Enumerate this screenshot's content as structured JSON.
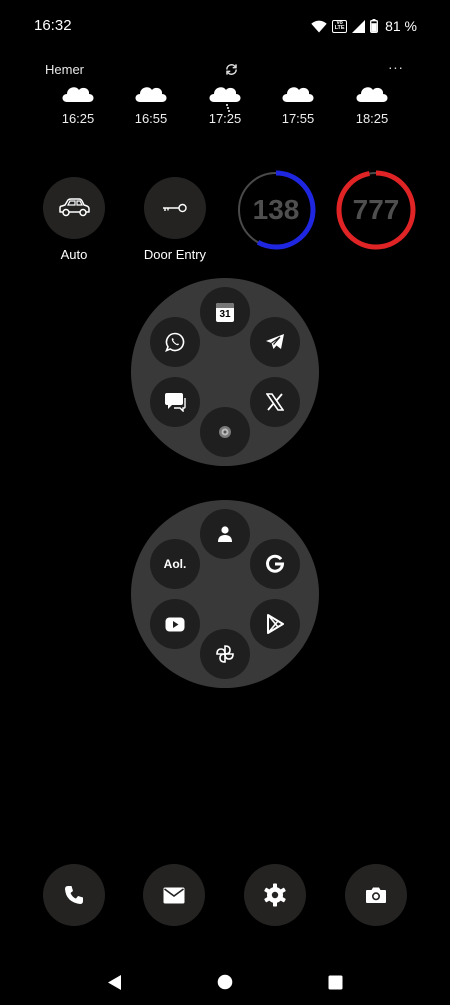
{
  "status_bar": {
    "time": "16:32",
    "volte": "Vo LTE",
    "battery": "81 %"
  },
  "weather": {
    "location": "Hemer",
    "more": "···",
    "forecast": [
      {
        "time": "16:25",
        "icon": "cloud-icon"
      },
      {
        "time": "16:55",
        "icon": "cloud-icon"
      },
      {
        "time": "17:25",
        "icon": "cloud-drizzle-icon"
      },
      {
        "time": "17:55",
        "icon": "cloud-icon"
      },
      {
        "time": "18:25",
        "icon": "cloud-icon"
      }
    ]
  },
  "shortcuts": {
    "auto": {
      "label": "Auto",
      "icon": "car-icon"
    },
    "door": {
      "label": "Door Entry",
      "icon": "key-icon"
    }
  },
  "counters": {
    "blue": {
      "value": "138",
      "color": "#1f26e0",
      "progress": 0.58
    },
    "red": {
      "value": "777",
      "color": "#e02426",
      "progress": 0.97
    }
  },
  "folder_1": {
    "apps": [
      {
        "name": "Calendar",
        "icon": "calendar-icon",
        "text": "31"
      },
      {
        "name": "Telegram",
        "icon": "telegram-icon"
      },
      {
        "name": "X",
        "icon": "x-logo-icon"
      },
      {
        "name": "Camera",
        "icon": "camera-lens-icon"
      },
      {
        "name": "Messages",
        "icon": "chat-bubble-icon"
      },
      {
        "name": "WhatsApp",
        "icon": "whatsapp-icon"
      }
    ]
  },
  "folder_2": {
    "apps": [
      {
        "name": "Contacts",
        "icon": "contacts-icon"
      },
      {
        "name": "Google",
        "icon": "google-icon"
      },
      {
        "name": "Play Store",
        "icon": "play-store-icon"
      },
      {
        "name": "Pinwheel",
        "icon": "pinwheel-icon"
      },
      {
        "name": "YouTube",
        "icon": "youtube-icon"
      },
      {
        "name": "AOL",
        "icon": "aol-icon",
        "text": "Aol."
      }
    ]
  },
  "dock": [
    {
      "name": "Phone",
      "icon": "phone-icon"
    },
    {
      "name": "Mail",
      "icon": "mail-icon"
    },
    {
      "name": "Settings",
      "icon": "gear-icon"
    },
    {
      "name": "Camera",
      "icon": "camera-icon"
    }
  ],
  "colors": {
    "background": "#000000",
    "button": "#242322",
    "folder": "#3a3939",
    "app": "#201f1f"
  }
}
